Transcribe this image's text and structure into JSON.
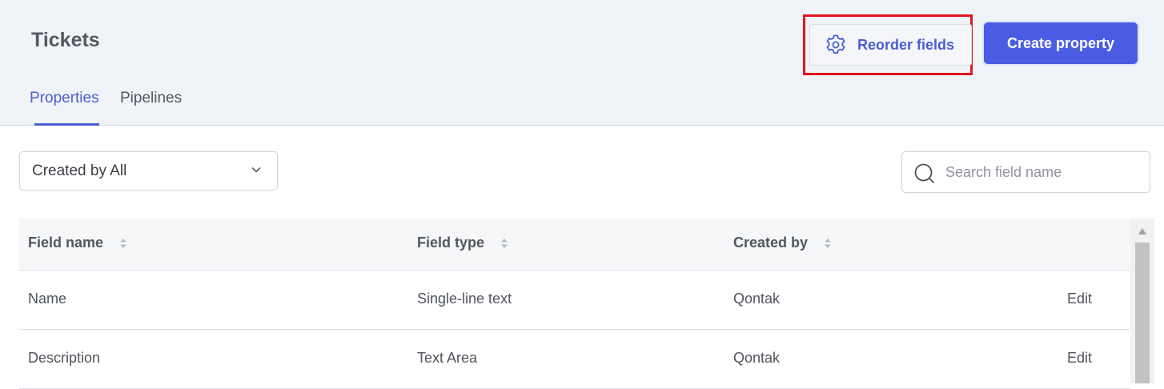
{
  "header": {
    "title": "Tickets",
    "reorder_label": "Reorder fields",
    "reorder_icon": "gear-icon",
    "create_label": "Create property",
    "accent_color": "#4a5de2",
    "highlight_color": "#e0141f"
  },
  "tabs": [
    {
      "label": "Properties",
      "active": true
    },
    {
      "label": "Pipelines",
      "active": false
    }
  ],
  "filter": {
    "selected": "Created by All",
    "icon": "chevron-down-icon"
  },
  "search": {
    "placeholder": "Search field name",
    "value": "",
    "icon": "search-icon"
  },
  "table": {
    "columns": [
      "Field name",
      "Field type",
      "Created by"
    ],
    "rows": [
      {
        "name": "Name",
        "type": "Single-line text",
        "created_by": "Qontak",
        "action": "Edit"
      },
      {
        "name": "Description",
        "type": "Text Area",
        "created_by": "Qontak",
        "action": "Edit"
      }
    ]
  }
}
